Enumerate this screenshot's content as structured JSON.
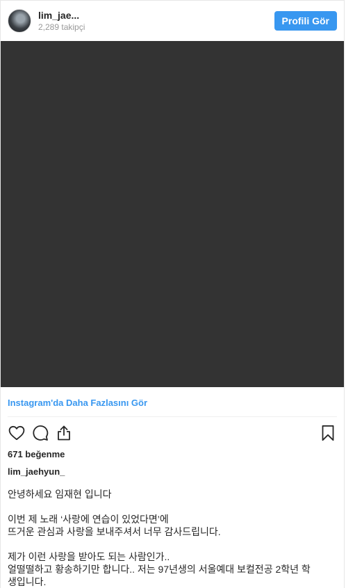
{
  "header": {
    "username": "lim_jae...",
    "followers": "2,289 takipçi",
    "profile_button": "Profili Gör"
  },
  "media": {
    "color": "#333333"
  },
  "more_link": "Instagram'da Daha Fazlasını Gör",
  "actions": {
    "icons": [
      "heart-icon",
      "comment-icon",
      "share-icon",
      "bookmark-icon"
    ]
  },
  "likes": "671 beğenme",
  "caption": {
    "username": "lim_jaehyun_",
    "p1": [
      "안녕하세요 임재현 입니다"
    ],
    "p2": [
      "이번 제 노래 ‘사랑에 연습이 있었다면’에",
      "뜨거운 관심과 사랑을 보내주셔서 너무 감사드립니다."
    ],
    "p3": [
      "제가 이런 사랑을 받아도 되는 사람인가..",
      "얼떨떨하고 황송하기만 합니다.. 저는 97년생의 서울예대 보컬전공 2학년 학",
      "생입니다."
    ]
  },
  "colors": {
    "accent": "#3897f0",
    "text": "#262626",
    "muted": "#999999"
  }
}
